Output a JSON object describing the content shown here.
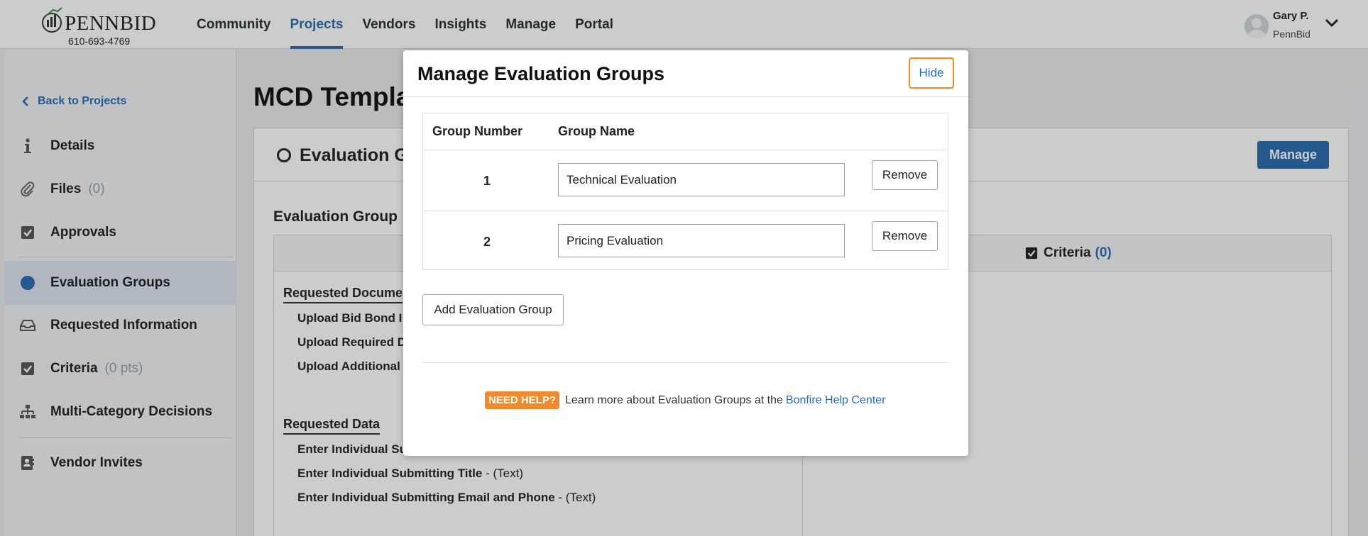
{
  "brand": {
    "logo_text": "PENNBID",
    "phone": "610-693-4769"
  },
  "nav": {
    "items": [
      {
        "label": "Community",
        "active": false
      },
      {
        "label": "Projects",
        "active": true
      },
      {
        "label": "Vendors",
        "active": false
      },
      {
        "label": "Insights",
        "active": false
      },
      {
        "label": "Manage",
        "active": false
      },
      {
        "label": "Portal",
        "active": false
      }
    ]
  },
  "user": {
    "name": "Gary P.",
    "org": "PennBid"
  },
  "sidebar": {
    "back_label": "Back to Projects",
    "items": [
      {
        "label": "Details",
        "count": "",
        "icon": "info-icon"
      },
      {
        "label": "Files",
        "count": "(0)",
        "icon": "paperclip-icon"
      },
      {
        "label": "Approvals",
        "count": "",
        "icon": "checkbox-icon"
      },
      {
        "label": "Evaluation Groups",
        "count": "",
        "icon": "circle-icon",
        "active": true
      },
      {
        "label": "Requested Information",
        "count": "",
        "icon": "inbox-icon"
      },
      {
        "label": "Criteria",
        "count": "(0 pts)",
        "icon": "checkbox-icon"
      },
      {
        "label": "Multi-Category Decisions",
        "count": "",
        "icon": "hierarchy-icon"
      },
      {
        "label": "Vendor Invites",
        "count": "",
        "icon": "contact-card-icon"
      }
    ]
  },
  "main": {
    "title": "MCD Templa",
    "card_title": "Evaluation G",
    "manage_label": "Manage",
    "section_title": "Evaluation Group",
    "criteria_label": "Criteria",
    "criteria_count": "(0)",
    "requested_documents": {
      "title": "Requested Docume",
      "items": [
        "Upload Bid Bond I",
        "Upload Required D",
        "Upload Additional"
      ]
    },
    "requested_data": {
      "title": "Requested Data",
      "items": [
        {
          "label": "Enter Individual Su",
          "type": ""
        },
        {
          "label": "Enter Individual Submitting Title",
          "type": " - (Text)"
        },
        {
          "label": "Enter Individual Submitting Email and Phone",
          "type": " - (Text)"
        }
      ]
    }
  },
  "modal": {
    "title": "Manage Evaluation Groups",
    "hide_label": "Hide",
    "columns": [
      "Group Number",
      "Group Name"
    ],
    "rows": [
      {
        "number": "1",
        "name": "Technical Evaluation",
        "remove_label": "Remove"
      },
      {
        "number": "2",
        "name": "Pricing Evaluation",
        "remove_label": "Remove"
      }
    ],
    "add_label": "Add Evaluation Group",
    "help_badge": "NEED HELP?",
    "help_text": "Learn more about Evaluation Groups at the",
    "help_link": "Bonfire Help Center"
  },
  "colors": {
    "accent": "#2b6cb0",
    "help_badge": "#f08a2c"
  }
}
